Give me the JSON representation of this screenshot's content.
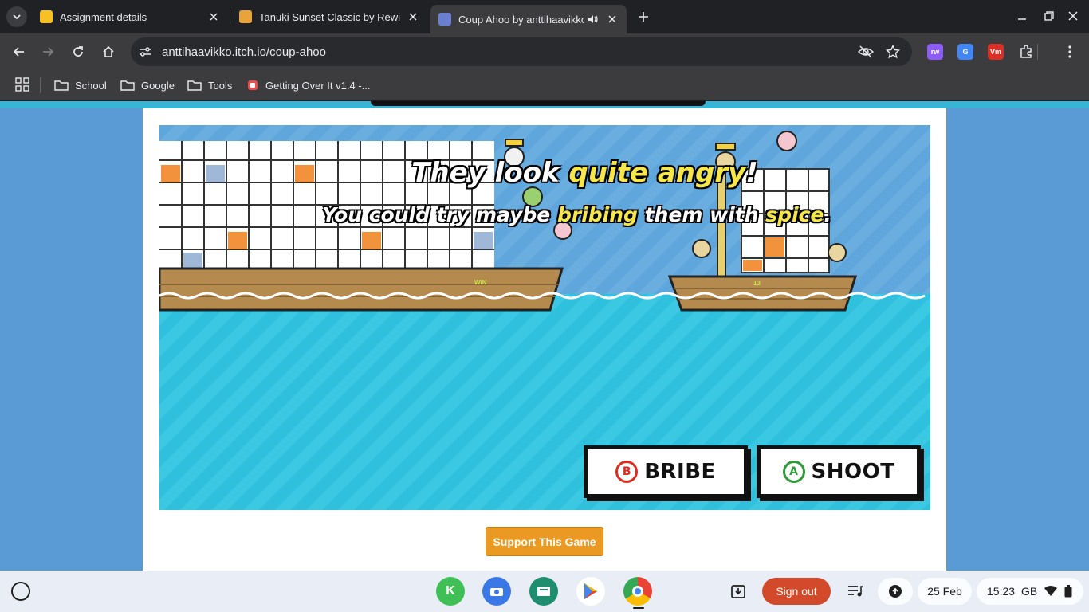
{
  "tabs": [
    {
      "title": "Assignment details",
      "favicon_color": "#f6c026"
    },
    {
      "title": "Tanuki Sunset Classic by Rewin",
      "favicon_color": "#e8a33a"
    },
    {
      "title": "Coup Ahoo by anttihaavikko",
      "favicon_color": "#6a7fd0",
      "active": true,
      "audio": true
    }
  ],
  "toolbar": {
    "url": "anttihaavikko.itch.io/coup-ahoo",
    "extensions": [
      {
        "name": "rw-extension",
        "text": "rw",
        "color": "#8b5cf6"
      },
      {
        "name": "translate-extension",
        "text": "G",
        "color": "#4285f4"
      },
      {
        "name": "video-extension",
        "text": "Vm",
        "color": "#d93025"
      }
    ]
  },
  "bookmarks": [
    {
      "label": "School"
    },
    {
      "label": "Google"
    },
    {
      "label": "Tools"
    },
    {
      "label": "Getting Over It v1.4 -..."
    }
  ],
  "game": {
    "msg1_a": "They look ",
    "msg1_b": "quite angry",
    "msg1_c": "!",
    "msg2_a": "You could try maybe ",
    "msg2_b": "bribing",
    "msg2_c": " them with ",
    "msg2_d": "spice",
    "msg2_e": ".",
    "bribe": {
      "glyph": "B",
      "label": "BRIBE",
      "color": "#e02b20"
    },
    "shoot": {
      "glyph": "A",
      "label": "SHOOT",
      "color": "#2e9a3a"
    },
    "ship_left_tag": "WIN",
    "ship_right_tag": "13"
  },
  "page": {
    "support_label": "Support This Game"
  },
  "shelf": {
    "signout": "Sign out",
    "date": "25 Feb",
    "time": "15:23",
    "region": "GB"
  }
}
